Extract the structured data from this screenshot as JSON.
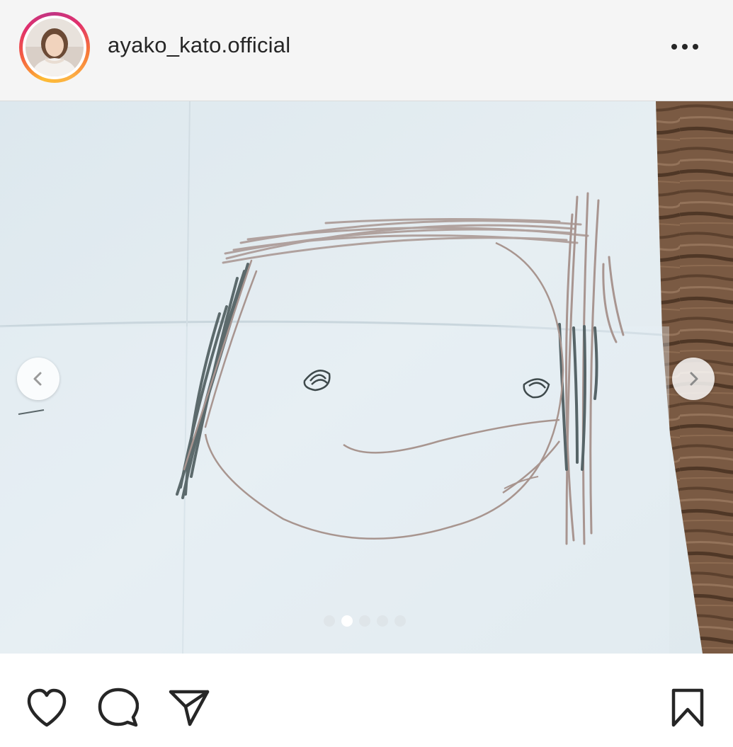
{
  "post": {
    "username": "ayako_kato.official",
    "more_icon": "more-horizontal-icon"
  },
  "carousel": {
    "slide_count": 5,
    "active_index": 1,
    "prev_icon": "chevron-left-icon",
    "next_icon": "chevron-right-icon"
  },
  "actions": {
    "like_icon": "heart-icon",
    "comment_icon": "comment-icon",
    "share_icon": "paper-plane-icon",
    "save_icon": "bookmark-icon"
  },
  "colors": {
    "header_bg": "#f5f5f5",
    "text": "#262626",
    "ring_gradient": [
      "#fdbb34",
      "#f56040",
      "#e1306c",
      "#c13584"
    ]
  }
}
